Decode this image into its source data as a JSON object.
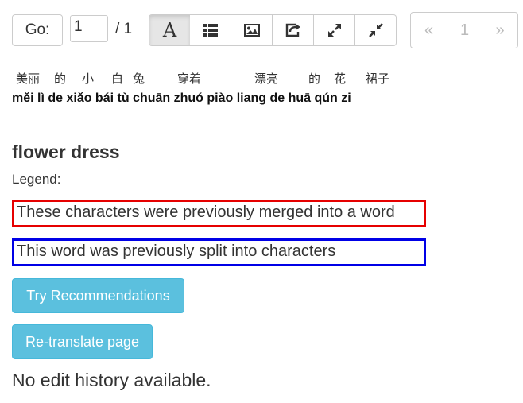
{
  "nav": {
    "go_label": "Go:",
    "page_value": "1",
    "page_total": "/ 1"
  },
  "toolbar": {
    "icons": [
      "font-icon",
      "list-icon",
      "image-icon",
      "share-icon",
      "expand-icon",
      "compress-icon"
    ],
    "active": "font-icon"
  },
  "pagination": {
    "prev": "«",
    "current": "1",
    "next": "»"
  },
  "sentence": {
    "words": [
      {
        "hanzi": "美丽",
        "pinyin": "měi lì"
      },
      {
        "hanzi": "的",
        "pinyin": "de"
      },
      {
        "hanzi": "小",
        "pinyin": "xiǎo"
      },
      {
        "hanzi": "白",
        "pinyin": "bái"
      },
      {
        "hanzi": "兔",
        "pinyin": "tù"
      },
      {
        "hanzi": "穿着",
        "pinyin": "chuān zhuó"
      },
      {
        "hanzi": "漂亮",
        "pinyin": "piào liang"
      },
      {
        "hanzi": "的",
        "pinyin": "de"
      },
      {
        "hanzi": "花",
        "pinyin": "huā"
      },
      {
        "hanzi": "裙子",
        "pinyin": "qún zi"
      }
    ],
    "pinyin_line": "měi lì de xiǎo bái tù chuān zhuó piào liang de huā qún zi"
  },
  "panel": {
    "title": "flower dress",
    "legend_label": "Legend:",
    "legend_merged": "These characters were previously merged into a word",
    "legend_split": "This word was previously split into characters",
    "try_recommendations": "Try Recommendations",
    "retranslate": "Re-translate page",
    "history_text": "No edit history available."
  },
  "colors": {
    "merged_border": "#e60000",
    "split_border": "#0000e6",
    "info_button": "#5bc0de"
  }
}
